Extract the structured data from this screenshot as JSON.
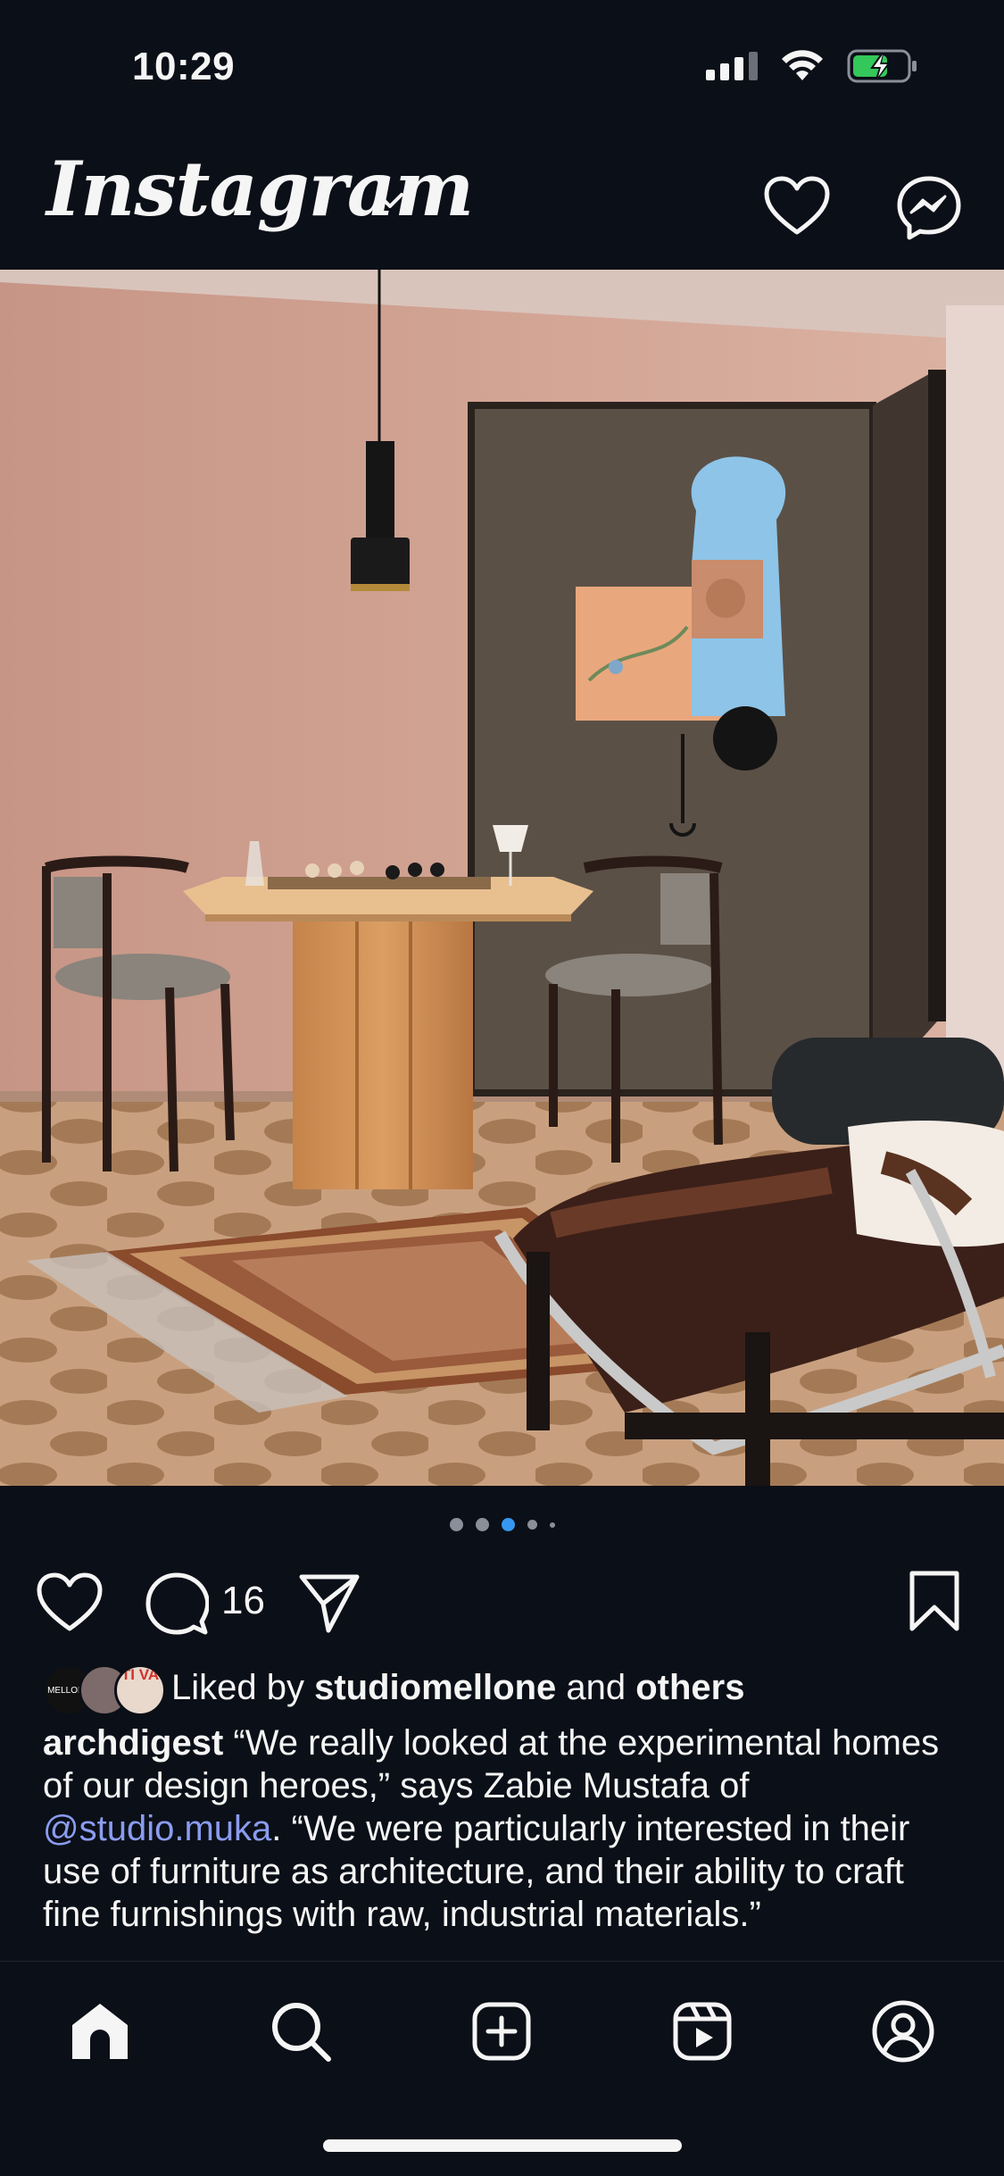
{
  "status_bar": {
    "time": "10:29",
    "icons": [
      "signal-icon",
      "wifi-icon",
      "battery-charging-icon"
    ]
  },
  "header": {
    "app_name": "Instagram",
    "icons": [
      "chevron-down-icon",
      "heart-icon",
      "messenger-icon"
    ]
  },
  "post": {
    "image_icon": "interior-photo",
    "carousel": {
      "total": 5,
      "active_index": 3
    },
    "actions": {
      "icons": [
        "heart-icon",
        "comment-icon",
        "send-icon",
        "bookmark-icon"
      ],
      "comment_count": "16"
    },
    "liked_by": {
      "prefix": "Liked by ",
      "user": "studiomellone",
      "middle": " and ",
      "others": "others",
      "avatar_texts": [
        "MELLONE",
        "TI VA"
      ]
    },
    "caption": {
      "username": "archdigest",
      "text_before_mention": " “We really looked at the experimental homes of our design heroes,” says Zabie Mustafa of ",
      "mention": "@studio.muka",
      "text_after_mention": ". “We were particularly interested in their use of furniture as architecture, and their ability to craft fine furnishings with raw, industrial materials.”"
    }
  },
  "bottom_nav": {
    "items": [
      "home-icon",
      "search-icon",
      "create-icon",
      "reels-icon",
      "profile-icon"
    ]
  },
  "colors": {
    "background": "#0b0f17",
    "active_dot": "#3797f0",
    "mention": "#8a9cf0"
  }
}
